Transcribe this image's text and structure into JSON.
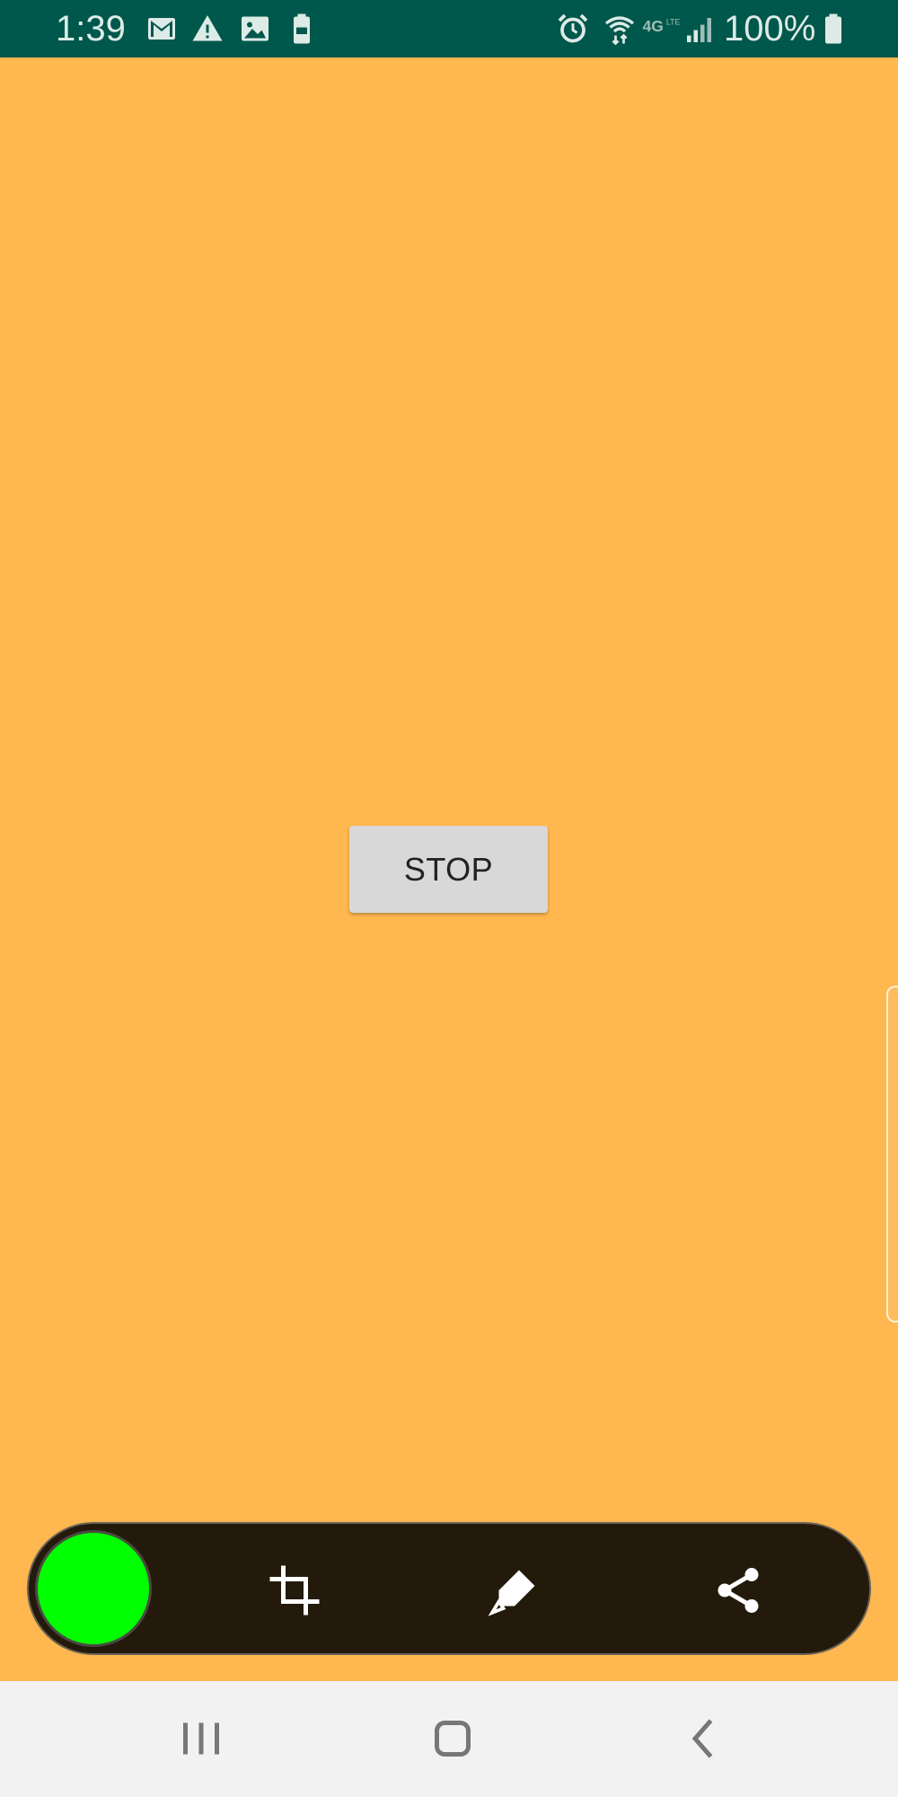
{
  "status_bar": {
    "time": "1:39",
    "battery_percent": "100%",
    "left_icons": [
      "gmail-icon",
      "warning-icon",
      "image-icon",
      "battery-saver-icon"
    ],
    "right_icons": [
      "alarm-icon",
      "wifi-icon",
      "lte-icon",
      "signal-icon",
      "battery-icon"
    ],
    "background_color": "#00574B"
  },
  "content": {
    "background_color": "#FFB74F",
    "stop_button_label": "STOP"
  },
  "toolbar": {
    "record_indicator_color": "#00FF00",
    "tools": [
      "crop-icon",
      "highlighter-icon",
      "share-icon"
    ]
  },
  "nav_bar": {
    "buttons": [
      "recents-icon",
      "home-icon",
      "back-icon"
    ]
  }
}
